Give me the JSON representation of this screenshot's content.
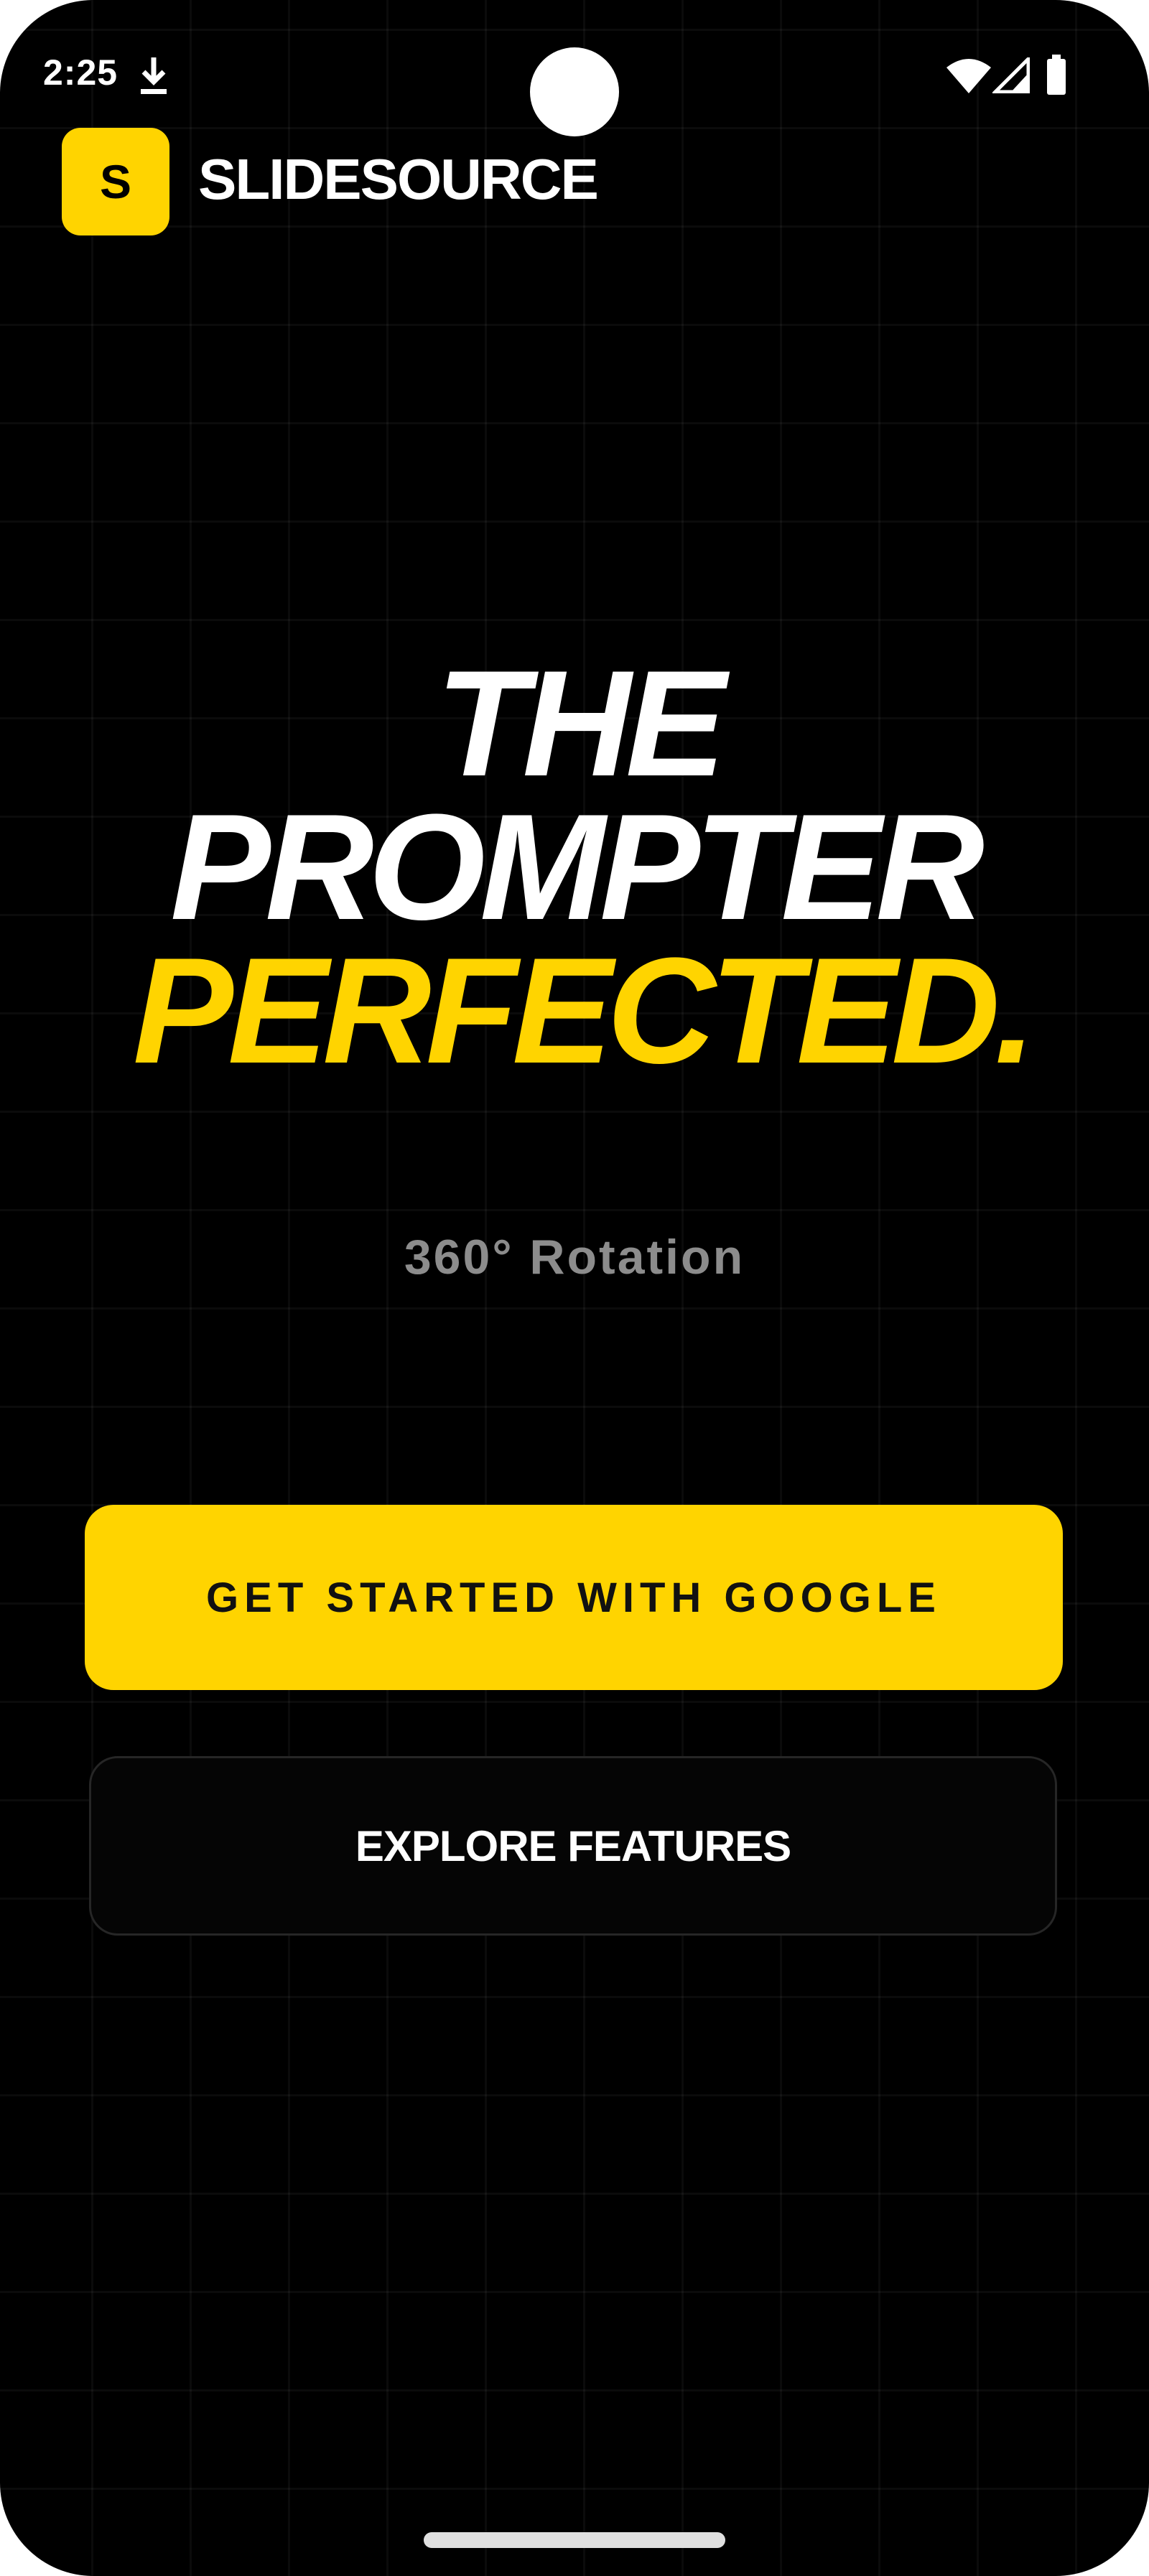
{
  "status_bar": {
    "time": "2:25",
    "icons": [
      "download-icon",
      "wifi-icon",
      "signal-icon",
      "battery-icon"
    ]
  },
  "brand": {
    "logo_letter": "S",
    "name": "SLIDESOURCE"
  },
  "hero": {
    "headline_line1": "THE",
    "headline_line2": "PROMPTER",
    "headline_line3": "PERFECTED.",
    "subtitle": "360° Rotation"
  },
  "actions": {
    "primary_label": "GET STARTED WITH GOOGLE",
    "secondary_label": "EXPLORE FEATURES"
  },
  "colors": {
    "accent": "#ffd400",
    "background": "#000000",
    "text_primary": "#ffffff",
    "text_muted": "#8c8c8c"
  }
}
